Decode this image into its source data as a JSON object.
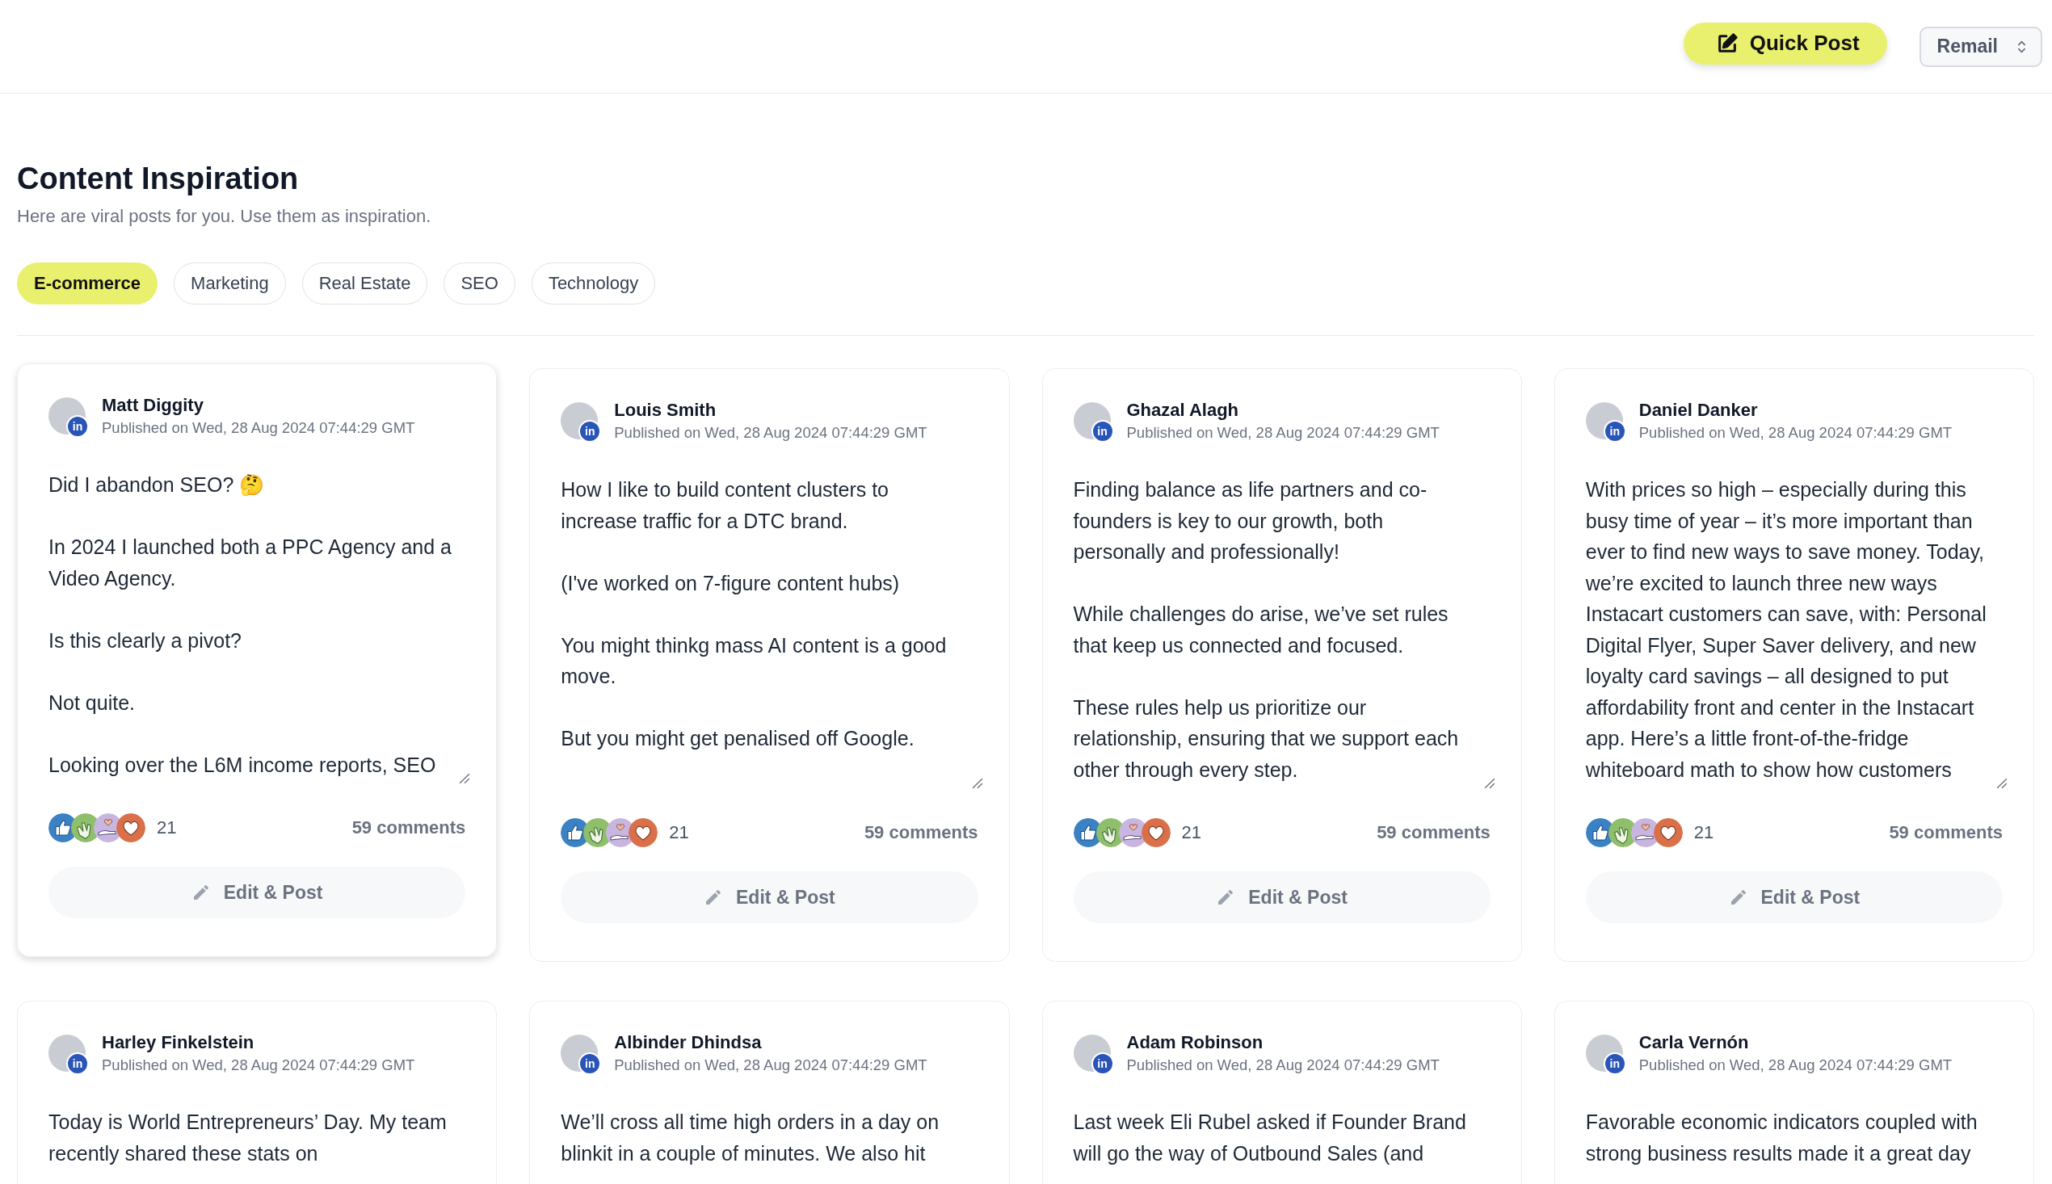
{
  "header": {
    "quick_post": "Quick Post",
    "account_select": "Remail"
  },
  "page": {
    "title": "Content Inspiration",
    "subtitle": "Here are viral posts for you. Use them as inspiration."
  },
  "tabs": [
    {
      "label": "E-commerce",
      "selected": true
    },
    {
      "label": "Marketing",
      "selected": false
    },
    {
      "label": "Real Estate",
      "selected": false
    },
    {
      "label": "SEO",
      "selected": false
    },
    {
      "label": "Technology",
      "selected": false
    }
  ],
  "posts": [
    {
      "author": "Matt Diggity",
      "network_badge": "in",
      "published": "Published on Wed, 28 Aug 2024 07:44:29 GMT",
      "raised": true,
      "paragraphs": [
        "Did I abandon SEO? 🤔",
        "In 2024 I launched both a PPC Agency and a Video Agency.",
        "Is this clearly a pivot?",
        "Not quite.",
        "Looking over the L6M income reports, SEO"
      ],
      "reactions": "21",
      "comments": "59 comments",
      "action": "Edit & Post"
    },
    {
      "author": "Louis Smith",
      "network_badge": "in",
      "published": "Published on Wed, 28 Aug 2024 07:44:29 GMT",
      "raised": false,
      "paragraphs": [
        "How I like to build content clusters to increase traffic for a DTC brand.",
        "(I've worked on 7-figure content hubs)",
        "You might thinkg mass AI content is a good move.",
        "But you might get penalised off Google."
      ],
      "reactions": "21",
      "comments": "59 comments",
      "action": "Edit & Post"
    },
    {
      "author": "Ghazal Alagh",
      "network_badge": "in",
      "published": "Published on Wed, 28 Aug 2024 07:44:29 GMT",
      "raised": false,
      "paragraphs": [
        "Finding balance as life partners and co-founders is key to our growth, both personally and professionally!",
        "While challenges do arise, we’ve set rules that keep us connected and focused.",
        "These rules help us prioritize our relationship, ensuring that we support each other through every step."
      ],
      "reactions": "21",
      "comments": "59 comments",
      "action": "Edit & Post"
    },
    {
      "author": "Daniel Danker",
      "network_badge": "in",
      "published": "Published on Wed, 28 Aug 2024 07:44:29 GMT",
      "raised": false,
      "paragraphs": [
        "With prices so high – especially during this busy time of year – it’s more important than ever to find new ways to save money. Today, we’re excited to launch three new ways Instacart customers can save, with: Personal Digital Flyer, Super Saver delivery, and new loyalty card savings – all designed to put affordability front and center in the Instacart app. Here’s a little front-of-the-fridge whiteboard math to show how customers"
      ],
      "reactions": "21",
      "comments": "59 comments",
      "action": "Edit & Post"
    },
    {
      "author": "Harley Finkelstein",
      "network_badge": "in",
      "published": "Published on Wed, 28 Aug 2024 07:44:29 GMT",
      "raised": false,
      "paragraphs": [
        "Today is World Entrepreneurs’ Day. My team recently shared these stats on"
      ]
    },
    {
      "author": "Albinder Dhindsa",
      "network_badge": "in",
      "published": "Published on Wed, 28 Aug 2024 07:44:29 GMT",
      "raised": false,
      "paragraphs": [
        "We’ll cross all time high orders in a day on blinkit in a couple of minutes. We also hit"
      ]
    },
    {
      "author": "Adam Robinson",
      "network_badge": "in",
      "published": "Published on Wed, 28 Aug 2024 07:44:29 GMT",
      "raised": false,
      "paragraphs": [
        "Last week Eli Rubel asked if Founder Brand will go the way of Outbound Sales (and"
      ]
    },
    {
      "author": "Carla Vernón",
      "network_badge": "in",
      "published": "Published on Wed, 28 Aug 2024 07:44:29 GMT",
      "raised": false,
      "paragraphs": [
        "Favorable economic indicators coupled with strong business results made it a great day"
      ]
    }
  ]
}
